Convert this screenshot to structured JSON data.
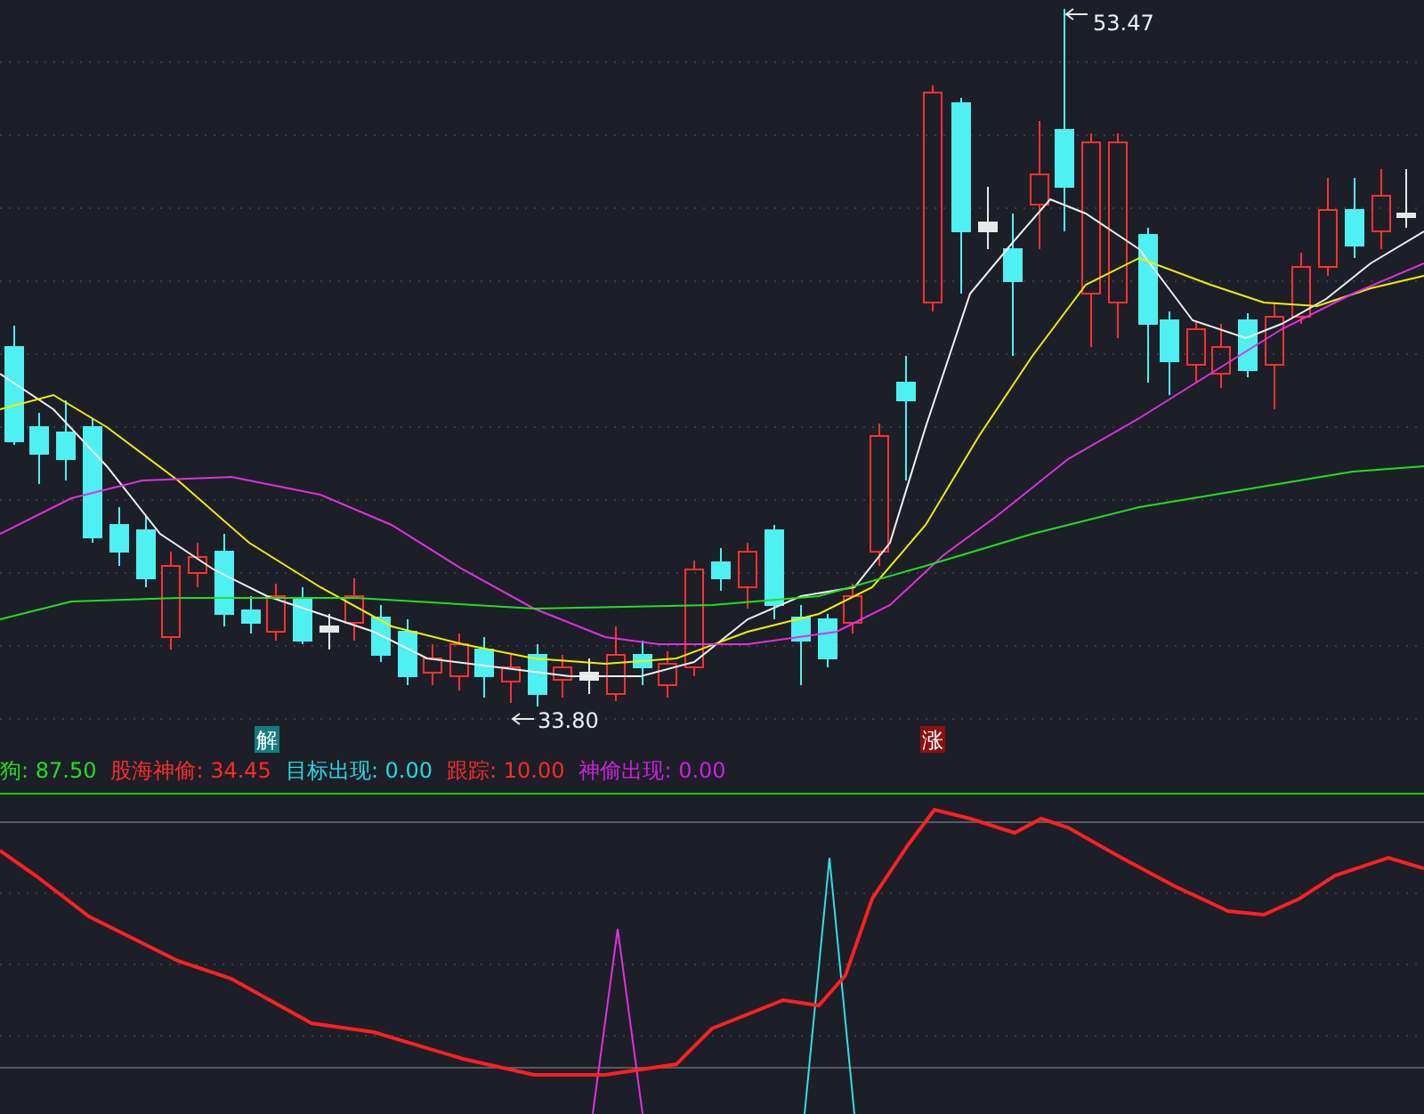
{
  "price_labels": [
    {
      "text": "53.47",
      "kind": "high"
    },
    {
      "text": "33.80",
      "kind": "low"
    }
  ],
  "signal_markers": [
    {
      "text": "解",
      "color": "#137c7c"
    },
    {
      "text": "涨",
      "color": "#8a1010"
    }
  ],
  "indicator_legend": [
    {
      "text": "狗: 87.50",
      "color": "#22dd22"
    },
    {
      "text": "股海神偷: 34.45",
      "color": "#ff2a2a"
    },
    {
      "text": "目标出现: 0.00",
      "color": "#28d8e0"
    },
    {
      "text": "跟踪: 10.00",
      "color": "#ff2a2a"
    },
    {
      "text": "神偷出现: 0.00",
      "color": "#d020e0"
    }
  ]
}
